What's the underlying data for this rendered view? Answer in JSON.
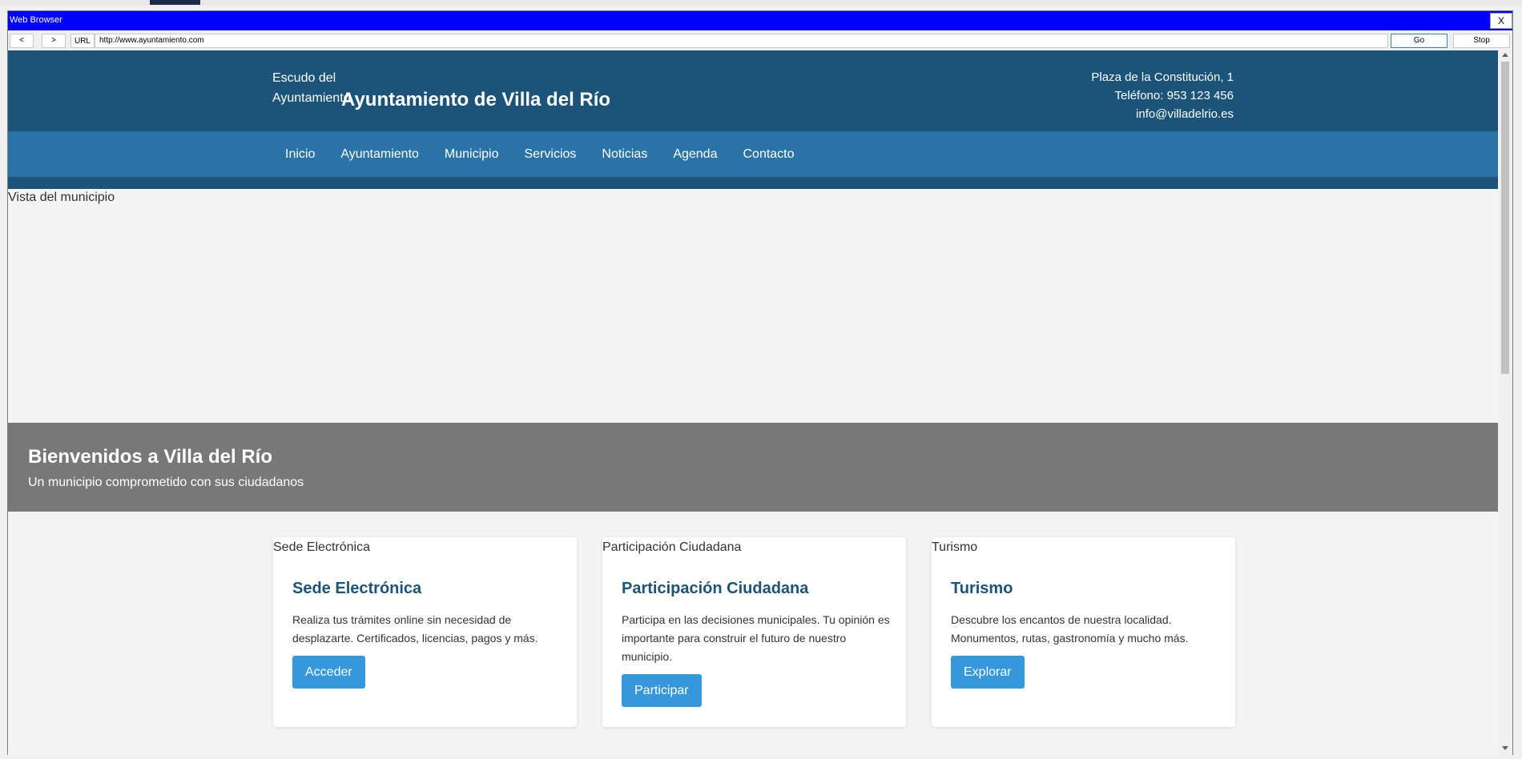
{
  "browser": {
    "title": "Web Browser",
    "close_label": "X",
    "back_label": "<",
    "forward_label": ">",
    "url_label": "URL",
    "url_value": "http://www.ayuntamiento.com",
    "go_label": "Go",
    "stop_label": "Stop"
  },
  "header": {
    "logo_alt": "Escudo del Ayuntamiento",
    "site_title": "Ayuntamiento de Villa del Río",
    "address": "Plaza de la Constitución, 1",
    "phone": "Teléfono: 953 123 456",
    "email": "info@villadelrio.es"
  },
  "nav": {
    "items": [
      {
        "label": "Inicio"
      },
      {
        "label": "Ayuntamiento"
      },
      {
        "label": "Municipio"
      },
      {
        "label": "Servicios"
      },
      {
        "label": "Noticias"
      },
      {
        "label": "Agenda"
      },
      {
        "label": "Contacto"
      }
    ]
  },
  "hero": {
    "image_alt": "Vista del municipio",
    "title": "Bienvenidos a Villa del Río",
    "subtitle": "Un municipio comprometido con sus ciudadanos"
  },
  "cards": [
    {
      "image_alt": "Sede Electrónica",
      "title": "Sede Electrónica",
      "text": "Realiza tus trámites online sin necesidad de desplazarte. Certificados, licencias, pagos y más.",
      "button": "Acceder"
    },
    {
      "image_alt": "Participación Ciudadana",
      "title": "Participación Ciudadana",
      "text": "Participa en las decisiones municipales. Tu opinión es importante para construir el futuro de nuestro municipio.",
      "button": "Participar"
    },
    {
      "image_alt": "Turismo",
      "title": "Turismo",
      "text": "Descubre los encantos de nuestra localidad. Monumentos, rutas, gastronomía y mucho más.",
      "button": "Explorar"
    }
  ],
  "colors": {
    "titlebar": "#0000ff",
    "header": "#1b5379",
    "nav": "#2a73a7",
    "banner": "#787878",
    "button": "#3498db"
  }
}
